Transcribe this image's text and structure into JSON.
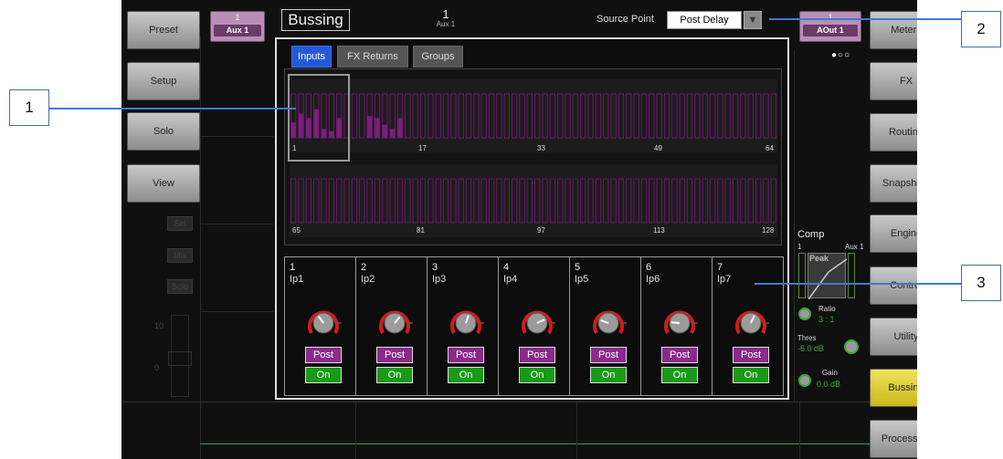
{
  "left_buttons": [
    "Preset",
    "Setup",
    "Solo",
    "View"
  ],
  "right_buttons": [
    "Meters",
    "FX",
    "Routing",
    "Snapshots",
    "Engine",
    "Control",
    "Utility",
    "Bussing",
    "Processing"
  ],
  "left_channel": {
    "num": "1",
    "name": "Aux 1"
  },
  "right_channel": {
    "num": "1",
    "name": "AOut 1"
  },
  "strip_buttons": [
    "Sel",
    "Mix",
    "Solo"
  ],
  "fader_marks": [
    "10",
    "0"
  ],
  "header": {
    "title": "Bussing",
    "aux_num": "1",
    "aux_name": "Aux 1",
    "source_label": "Source Point",
    "source_value": "Post Delay",
    "dropdown_arrow": "▼"
  },
  "page_dots": "●○○",
  "tabs": [
    "Inputs",
    "FX Returns",
    "Groups"
  ],
  "meter_labels_row1": [
    "1",
    "17",
    "33",
    "49",
    "64"
  ],
  "meter_labels_row2": [
    "65",
    "81",
    "97",
    "113",
    "128"
  ],
  "meter_levels_row1": [
    0.35,
    0.55,
    0.45,
    0.65,
    0.2,
    0.15,
    0.45,
    0,
    0,
    0,
    0.5,
    0.45,
    0.3,
    0.2,
    0.45
  ],
  "sends": [
    {
      "num": "1",
      "name": "Ip1",
      "post": "Post",
      "on": "On",
      "angle": -35
    },
    {
      "num": "2",
      "name": "Ip2",
      "post": "Post",
      "on": "On",
      "angle": 40
    },
    {
      "num": "3",
      "name": "Ip3",
      "post": "Post",
      "on": "On",
      "angle": 20
    },
    {
      "num": "4",
      "name": "Ip4",
      "post": "Post",
      "on": "On",
      "angle": 65
    },
    {
      "num": "5",
      "name": "Ip5",
      "post": "Post",
      "on": "On",
      "angle": -70
    },
    {
      "num": "6",
      "name": "Ip6",
      "post": "Post",
      "on": "On",
      "angle": -85
    },
    {
      "num": "7",
      "name": "Ip7",
      "post": "Post",
      "on": "On",
      "angle": 25
    }
  ],
  "comp": {
    "title": "Comp",
    "ch": "1",
    "aux": "Aux 1",
    "peak": "Peak",
    "ratio_label": "Ratio",
    "ratio_value": "3 : 1",
    "thres_label": "Thres",
    "thres_value": "-6.0 dB",
    "gain_label": "Gain",
    "gain_value": "0.0 dB"
  },
  "callouts": [
    "1",
    "2",
    "3"
  ],
  "colors": {
    "accent_active": "#2458d6",
    "meter_purple": "#7a1f7a",
    "post_purple": "#8a2a8a",
    "on_green": "#189a18",
    "bussing_yellow": "#e0d23a",
    "callout_blue": "#3b7dd0"
  }
}
